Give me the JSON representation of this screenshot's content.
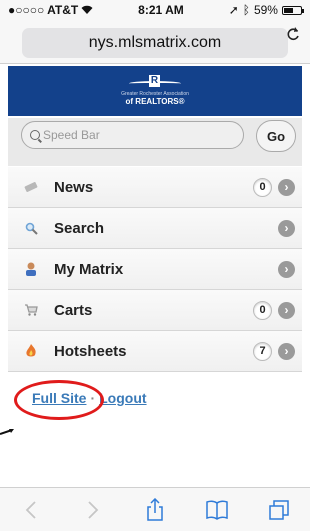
{
  "status_bar": {
    "carrier": "●○○○○ AT&T",
    "time": "8:21 AM",
    "battery_percent": "59%",
    "battery_level": 0.59
  },
  "browser": {
    "url": "nys.mlsmatrix.com",
    "reload_icon": "reload-icon"
  },
  "banner": {
    "logo_letter": "R",
    "association_text": "Greater Rochester Association",
    "realtors_text": "of REALTORS®"
  },
  "speed_bar": {
    "placeholder": "Speed Bar",
    "go_label": "Go"
  },
  "menu": {
    "items": [
      {
        "label": "News",
        "icon": "news-icon",
        "count": "0"
      },
      {
        "label": "Search",
        "icon": "search-icon",
        "count": ""
      },
      {
        "label": "My Matrix",
        "icon": "person-icon",
        "count": ""
      },
      {
        "label": "Carts",
        "icon": "cart-icon",
        "count": "0"
      },
      {
        "label": "Hotsheets",
        "icon": "fire-icon",
        "count": "7"
      }
    ]
  },
  "footer_links": {
    "full_site": "Full Site",
    "separator": "·",
    "logout": "Logout"
  },
  "toolbar": {
    "back": "back-icon",
    "forward": "forward-icon",
    "share": "share-icon",
    "bookmarks": "bookmarks-icon",
    "tabs": "tabs-icon"
  },
  "colors": {
    "banner_blue": "#13418b",
    "link_blue": "#3a7ab8",
    "annotation_red": "#e01b1b",
    "ios_blue": "#2f7bd8"
  }
}
